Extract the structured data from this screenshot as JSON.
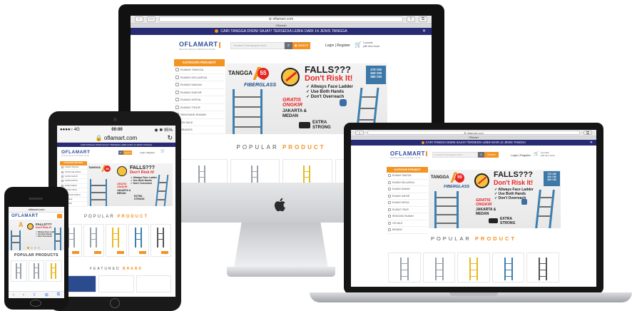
{
  "site": {
    "domain": "oflamart.com",
    "logo_text": "OFLAMART",
    "logo_tagline": "BELANJA TANGGA & PERKAKAS ONLINE",
    "promo_text": "CARI TANGGA DISINI SAJA!!! TERSEDIA LEBIH DARI 14 JENIS TANGGA",
    "search_placeholder": "Temukan Perlengkapan Disini",
    "search_button": "Search",
    "login": "Login | Register",
    "cart_line1": "0 produk",
    "cart_line2": "pilih item Anda",
    "category_header": "KATEGORI PERABOT",
    "categories": [
      "RUMAH TANGGA",
      "RUANG KELUARGA",
      "RUANG MAKAN",
      "RUANG DAPUR",
      "RUANG KERJA",
      "RUANG TIDUR",
      "RENOVASI RUMAH",
      "ON SALE",
      "BRANDS"
    ],
    "banner": {
      "tangga": "TANGGA",
      "a_mark": "A",
      "badge": "55",
      "brand": "FIBERGLASS",
      "falls": "FALLS???",
      "dont": "Don't Risk It!",
      "tips": [
        "✓ Allways Face Ladder",
        "✓ Use Both Hands",
        "✓ Don't Overreach"
      ],
      "sizes": [
        "170 CM",
        "320 CM",
        "360 CM"
      ],
      "gratis": "GRATIS",
      "ongkir": "ONGKIR",
      "cities": "JAKARTA & MEDAN",
      "strong1": "EXTRA",
      "strong2": "STRONG"
    },
    "popular_word1": "POPULAR",
    "popular_word2": "PRODUCT",
    "popular_products_label": "POPULAR PRODUCTS",
    "featured_word1": "FEATURED",
    "featured_word2": "BRAND"
  },
  "devices": {
    "tablet_carrier": "●●●●○ 4G",
    "tablet_time": "00:00",
    "tablet_battery": "◉ ✱ 95%",
    "tablet_url": "🔒 oflamart.com",
    "phone_url": "oflamart.com",
    "imac_tab": "Oflamart",
    "imac_url": "⊕ oflamart.com",
    "laptop_url": "⊕ oflamart.com",
    "laptop_tab": "Oflamart",
    "phone_logo_text": "OFLAMART"
  },
  "colors": {
    "accent": "#f39322",
    "navy": "#262b73",
    "ladder_blue": "#3d7fb0",
    "alert_red": "#e52521"
  }
}
